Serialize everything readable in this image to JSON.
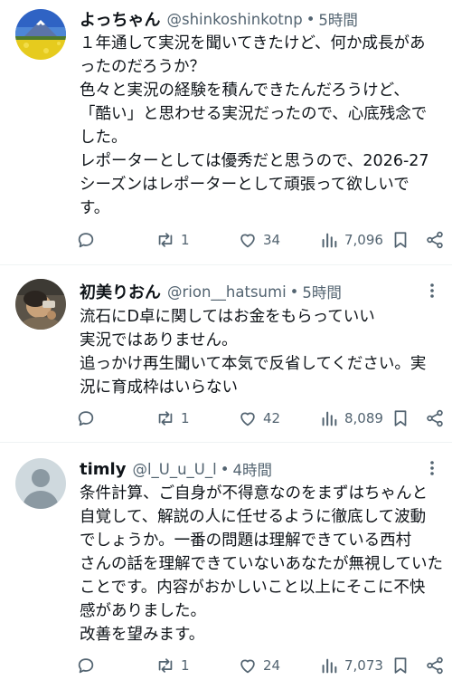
{
  "tweets": [
    {
      "name": "よっちゃん",
      "handle": "@shinkoshinkotnp",
      "sep": "•",
      "time": "5時間",
      "avatar": "landscape-avatar",
      "lines": [
        "１年通して実況を聞いてきたけど、何か成長があ",
        "ったのだろうか？",
        "色々と実況の経験を積んできたんだろうけど、",
        "「酷い」と思わせる実況だったので、心底残念で",
        "した。",
        "レポーターとしては優秀だと思うので、2026-27",
        "シーズンはレポーターとして頑張って欲しいで",
        "す。"
      ],
      "retweets": "1",
      "likes": "34",
      "views": "7,096"
    },
    {
      "name": "初美りおん",
      "handle": "@rion__hatsumi",
      "sep": "•",
      "time": "5時間",
      "avatar": "photo-avatar",
      "lines": [
        "流石にD卓に関してはお金をもらっていい",
        "実況ではありません。",
        "追っかけ再生聞いて本気で反省してください。実",
        "況に育成枠はいらない"
      ],
      "retweets": "1",
      "likes": "42",
      "views": "8,089"
    },
    {
      "name": "timly",
      "handle": "@l_U_u_U_l",
      "sep": "•",
      "time": "4時間",
      "avatar": "default-avatar",
      "lines": [
        "条件計算、ご自身が不得意なのをまずはちゃんと",
        "自覚して、解説の人に任せるように徹底して波動",
        "でしょうか。一番の問題は理解できている西村",
        "さんの話を理解できていないあなたが無視していた",
        "ことです。内容がおかしいこと以上にそこに不快",
        "感がありました。",
        "改善を望みます。"
      ],
      "retweets": "1",
      "likes": "24",
      "views": "7,073"
    }
  ],
  "colors": {
    "text": "#0f1419",
    "secondary": "#536471",
    "divider": "#eff3f4"
  }
}
